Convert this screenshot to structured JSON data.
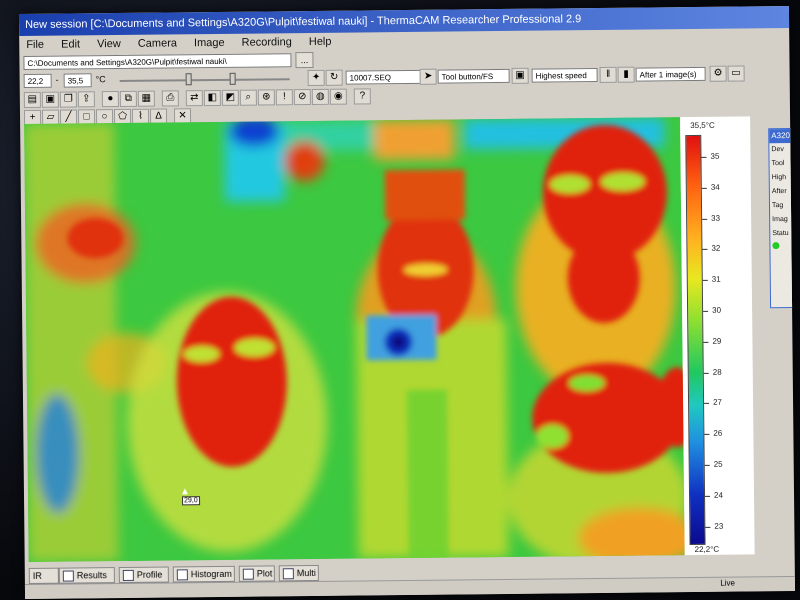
{
  "window": {
    "title": "New session [C:\\Documents and Settings\\A320G\\Pulpit\\festiwal nauki] - ThermaCAM Researcher Professional 2.9"
  },
  "menu": [
    "File",
    "Edit",
    "View",
    "Camera",
    "Image",
    "Recording",
    "Help"
  ],
  "path_field": "C:\\Documents and Settings\\A320G\\Pulpit\\festiwal nauki\\",
  "path_button": "...",
  "toolbar": {
    "range_min": "22,2",
    "range_sep": "-",
    "range_max": "35,5",
    "range_unit": "°C",
    "seq_field": "10007.SEQ",
    "tool_field": "Tool button/FS",
    "speed_field": "Highest speed",
    "after_field": "After 1 image(s)"
  },
  "scale": {
    "max_label": "35,5°C",
    "min_label": "22,2°C",
    "ticks": [
      "35",
      "34",
      "33",
      "32",
      "31",
      "30",
      "29",
      "28",
      "27",
      "26",
      "25",
      "24",
      "23"
    ]
  },
  "side_panel": {
    "title": "A320",
    "rows": [
      "Dev",
      "Tool",
      "High",
      "After",
      "Tag",
      "Imag",
      "Statu"
    ]
  },
  "cursor_readout": "29,0",
  "tabs": [
    "IR",
    "Results",
    "Profile",
    "Histogram",
    "Plot",
    "Multi"
  ],
  "status_right": "Live",
  "colors": {
    "hot": "#e01010",
    "warm": "#f0a020",
    "mid": "#30c840",
    "cool": "#20b8e0",
    "cold": "#1020b0"
  }
}
